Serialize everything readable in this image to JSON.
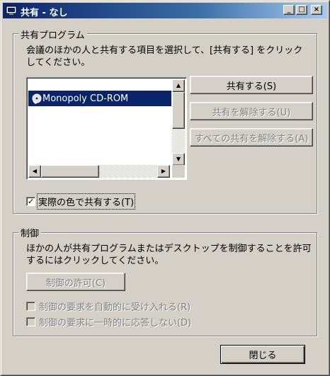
{
  "window": {
    "title": "共有 - なし",
    "controls": {
      "minimize": "_",
      "maximize": "□",
      "close": "×"
    }
  },
  "share_group": {
    "label": "共有プログラム",
    "description_line1": "会議のほかの人と共有する項目を選択して、[共有する] をクリック",
    "description_line2": "してください。",
    "list": {
      "items": [
        {
          "label": "Monopoly CD-ROM",
          "selected": true
        }
      ]
    },
    "share_button": "共有する(S)",
    "unshare_button": "共有を解除する(U)",
    "unshare_all_button": "すべての共有を解除する(A)",
    "true_color_checkbox": {
      "label": "実際の色で共有する(T)",
      "checked": true
    }
  },
  "control_group": {
    "label": "制御",
    "description_line1": "ほかの人が共有プログラムまたはデスクトップを制御することを許可",
    "description_line2": "するにはクリックしてください。",
    "allow_control_button": "制御の許可(C)",
    "auto_accept_checkbox": {
      "label": "制御の要求を自動的に受け入れる(R)",
      "checked": false
    },
    "dnd_checkbox": {
      "label": "制御の要求に一時的に応答しない(D)",
      "checked": false
    }
  },
  "close_button": "閉じる",
  "icons": {
    "title": "sharing-window-icon",
    "list_item": "cd-rom-program-icon"
  },
  "colors": {
    "selection": "#0a246a",
    "title_start": "#0a246a",
    "title_end": "#a6caf0"
  }
}
